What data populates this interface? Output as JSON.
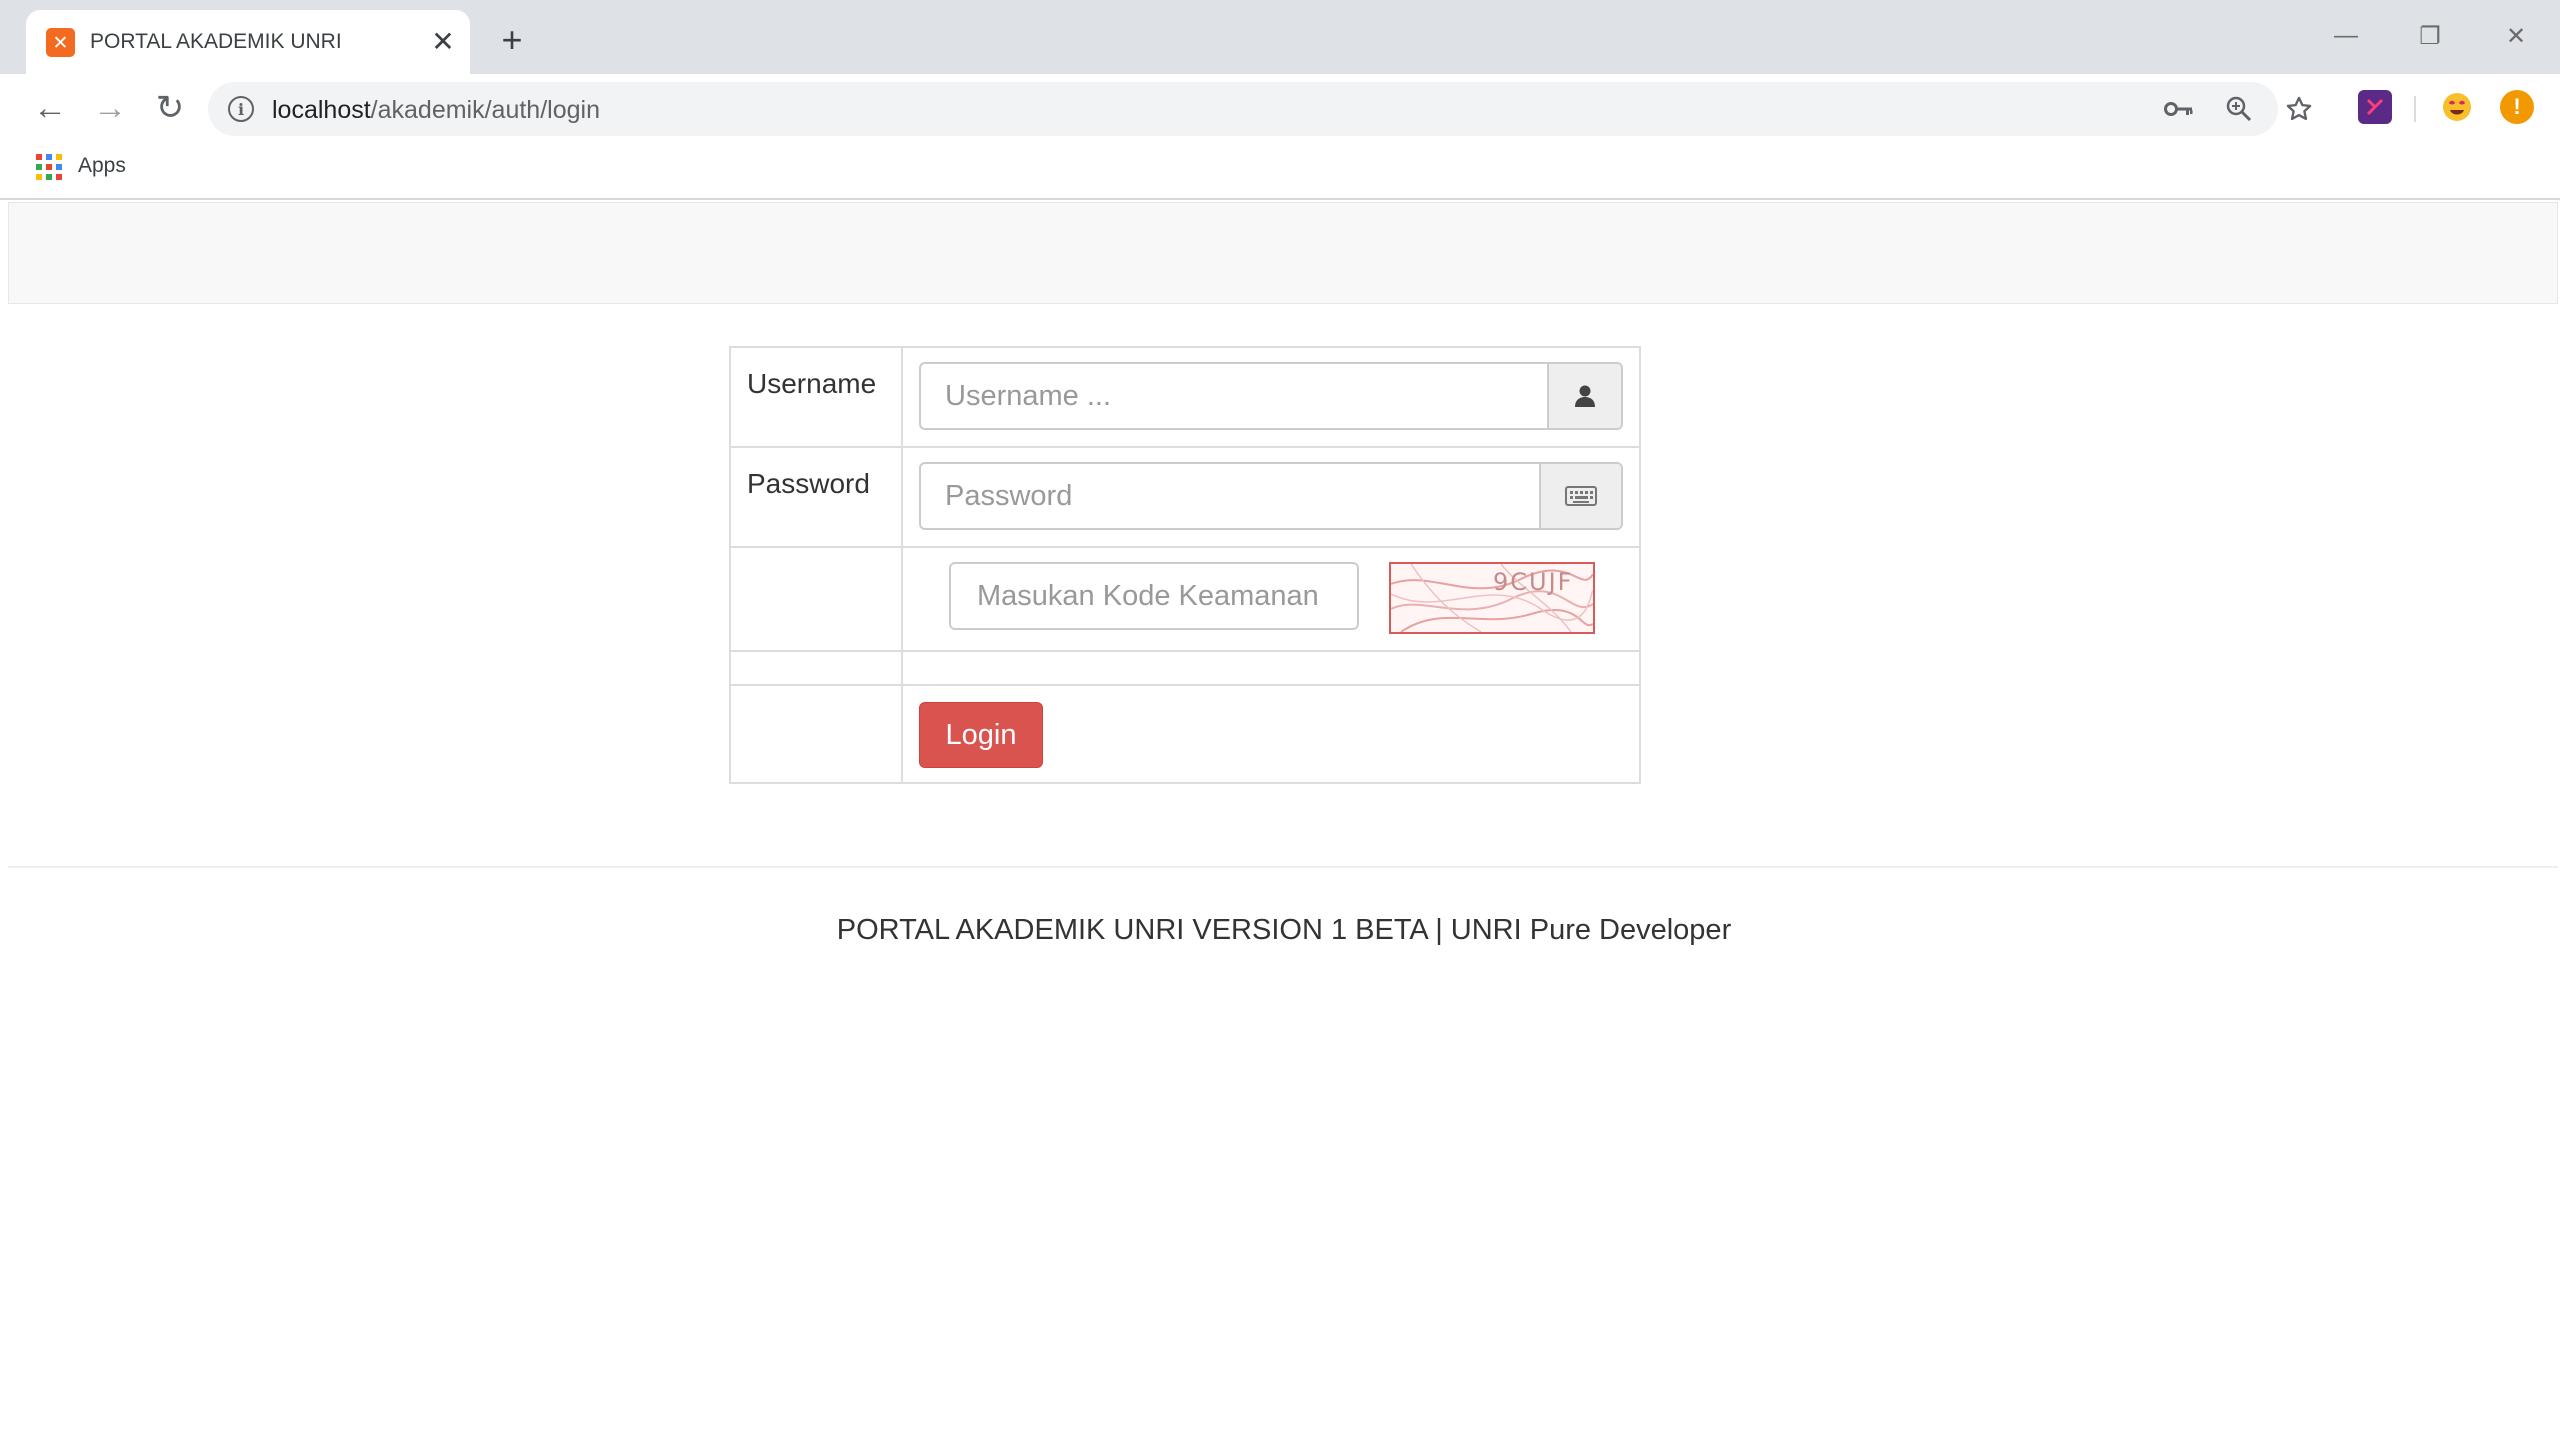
{
  "browser": {
    "tab": {
      "title": "PORTAL AKADEMIK UNRI",
      "favicon_glyph": "✕",
      "favicon_color": "#f36b21",
      "close_glyph": "✕"
    },
    "new_tab_glyph": "+",
    "window_controls": {
      "minimize": "—",
      "restore": "❐",
      "close": "✕"
    },
    "nav": {
      "back": "←",
      "forward": "→",
      "reload": "↻"
    },
    "address": {
      "host": "localhost",
      "path": "/akademik/auth/login"
    },
    "omnibox_icons": [
      "key-icon",
      "zoom-icon",
      "star-icon"
    ],
    "extensions": [
      "extension-icon-purple",
      "extension-icon-emoji",
      "update-alert-icon"
    ],
    "bookmarks": {
      "apps_label": "Apps"
    }
  },
  "login_form": {
    "username": {
      "label": "Username",
      "placeholder": "Username ...",
      "value": ""
    },
    "password": {
      "label": "Password",
      "placeholder": "Password",
      "value": ""
    },
    "captcha": {
      "placeholder": "Masukan Kode Keamanan",
      "value": "",
      "code_text": "9CUJF"
    },
    "submit_label": "Login"
  },
  "footer": {
    "text": "PORTAL AKADEMIK UNRI VERSION 1 BETA | UNRI Pure Developer"
  },
  "colors": {
    "primary_button": "#d9534f",
    "header_bg": "#f8f8f8",
    "border": "#dddddd"
  }
}
